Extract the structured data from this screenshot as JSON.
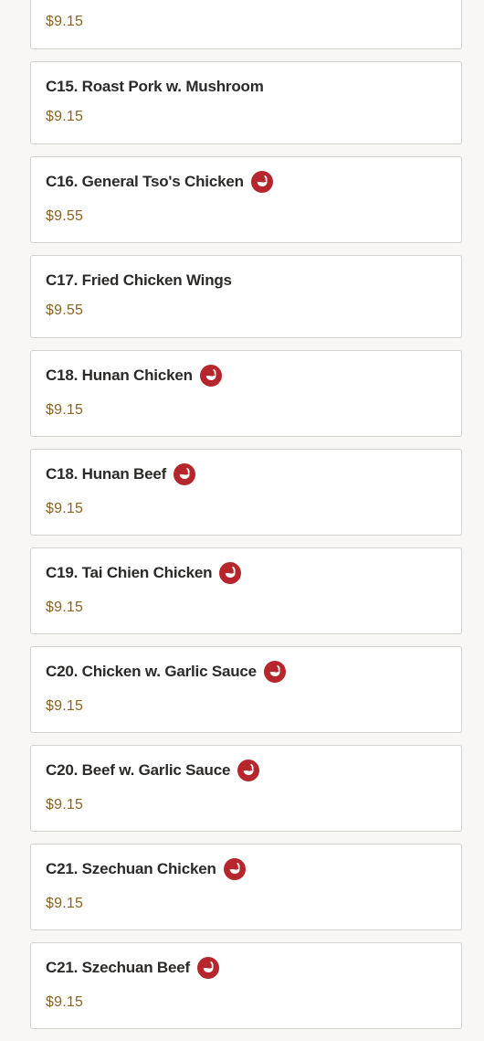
{
  "colors": {
    "page_background": "#f8f7f5",
    "card_background": "#ffffff",
    "card_border": "#d4d2cf",
    "name_text": "#2b2a28",
    "price_text": "#8a6420",
    "spicy_icon": "#b5272d"
  },
  "menu": {
    "items": [
      {
        "name": "",
        "price": "$9.15",
        "spicy": false
      },
      {
        "name": "C15. Roast Pork w. Mushroom",
        "price": "$9.15",
        "spicy": false
      },
      {
        "name": "C16. General Tso's Chicken",
        "price": "$9.55",
        "spicy": true,
        "icon": "spicy-pepper-icon"
      },
      {
        "name": "C17. Fried Chicken Wings",
        "price": "$9.55",
        "spicy": false
      },
      {
        "name": "C18. Hunan Chicken",
        "price": "$9.15",
        "spicy": true,
        "icon": "spicy-pepper-icon"
      },
      {
        "name": "C18. Hunan Beef",
        "price": "$9.15",
        "spicy": true,
        "icon": "spicy-pepper-icon"
      },
      {
        "name": "C19. Tai Chien Chicken",
        "price": "$9.15",
        "spicy": true,
        "icon": "spicy-pepper-icon"
      },
      {
        "name": "C20. Chicken w. Garlic Sauce",
        "price": "$9.15",
        "spicy": true,
        "icon": "spicy-pepper-icon"
      },
      {
        "name": "C20. Beef w. Garlic Sauce",
        "price": "$9.15",
        "spicy": true,
        "icon": "spicy-pepper-icon"
      },
      {
        "name": "C21. Szechuan Chicken",
        "price": "$9.15",
        "spicy": true,
        "icon": "spicy-pepper-icon"
      },
      {
        "name": "C21. Szechuan Beef",
        "price": "$9.15",
        "spicy": true,
        "icon": "spicy-pepper-icon"
      }
    ]
  }
}
